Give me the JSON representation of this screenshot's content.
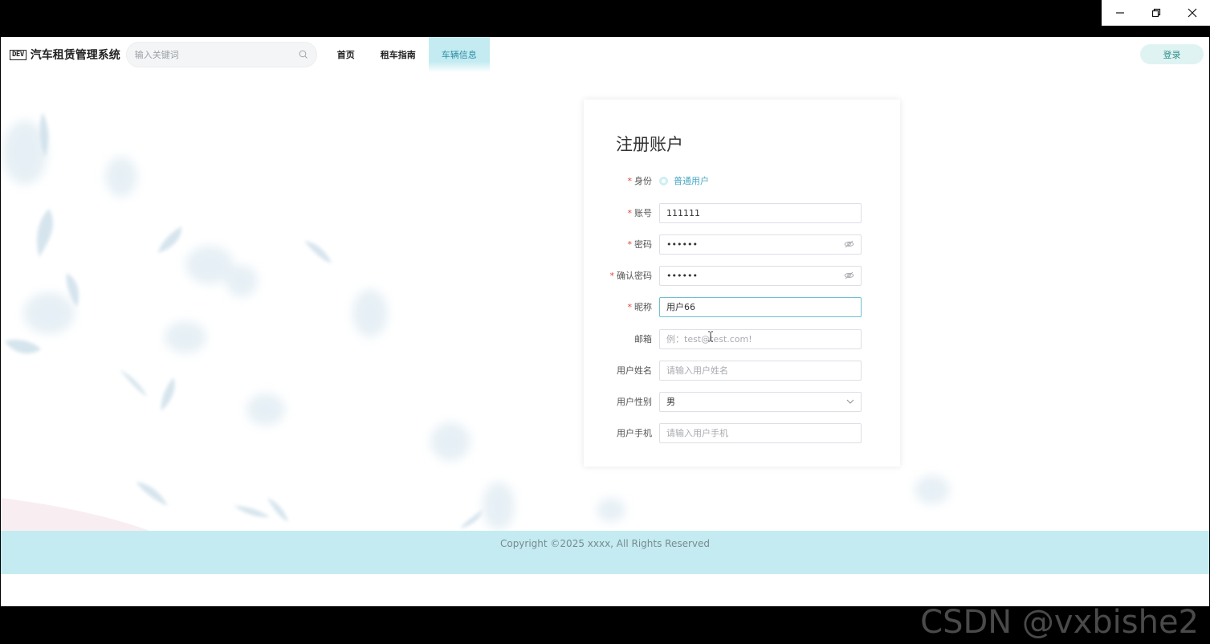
{
  "app": {
    "title": "汽车租赁管理系统",
    "logo_badge": "DEV"
  },
  "search": {
    "placeholder": "输入关键词"
  },
  "nav": {
    "items": [
      {
        "label": "首页"
      },
      {
        "label": "租车指南"
      },
      {
        "label": "车辆信息"
      }
    ],
    "login_label": "登录"
  },
  "form": {
    "title": "注册账户",
    "identity": {
      "label": "身份",
      "option": "普通用户"
    },
    "account": {
      "label": "账号",
      "value": "111111"
    },
    "password": {
      "label": "密码",
      "value": "111111"
    },
    "confirm_password": {
      "label": "确认密码",
      "value": "111111"
    },
    "nickname": {
      "label": "昵称",
      "value": "用户66"
    },
    "email": {
      "label": "邮箱",
      "placeholder": "例：test@test.com!"
    },
    "username": {
      "label": "用户姓名",
      "placeholder": "请输入用户姓名"
    },
    "gender": {
      "label": "用户性别",
      "value": "男"
    },
    "phone": {
      "label": "用户手机",
      "placeholder": "请输入用户手机"
    },
    "required_mark": "*"
  },
  "footer": {
    "copyright": "Copyright ©2025 xxxx, All Rights Reserved"
  },
  "watermark": "CSDN @vxbishe2",
  "colors": {
    "accent": "#c3ebf1",
    "accent_text": "#2e8da4",
    "login_bg": "#e0f3f3",
    "required": "#e0443f"
  }
}
